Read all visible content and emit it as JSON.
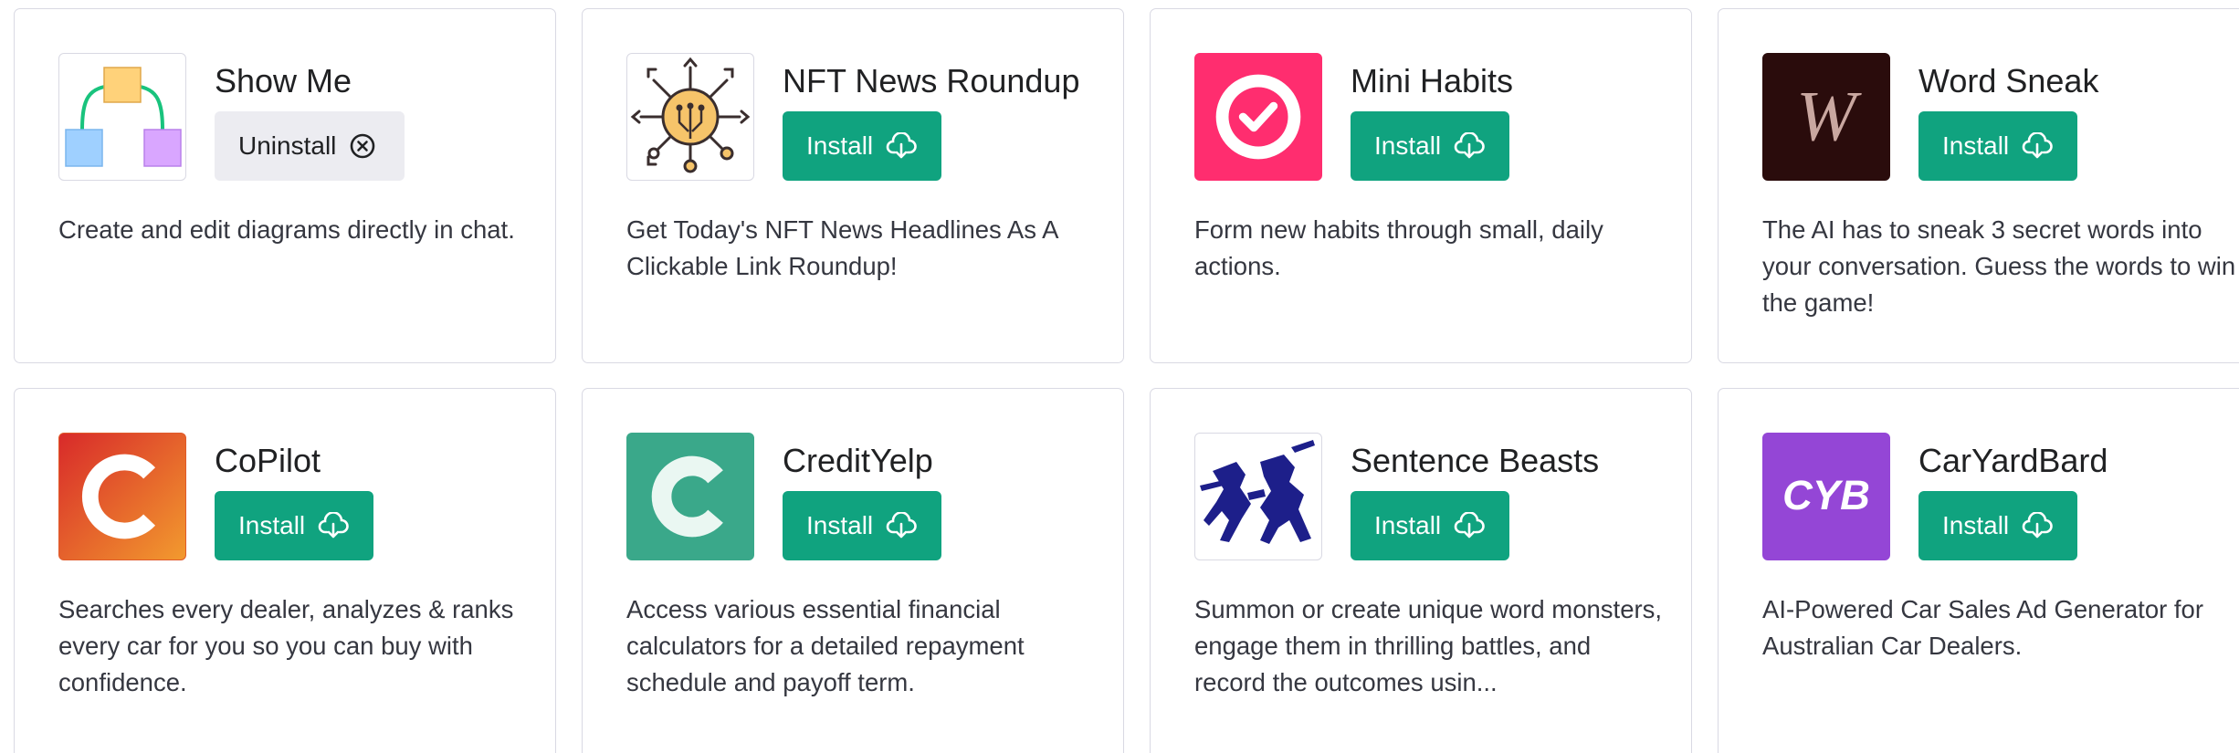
{
  "colors": {
    "install_bg": "#10a37f",
    "uninstall_bg": "#ececf1",
    "card_border": "#d9d9e3"
  },
  "plugins": [
    {
      "name": "Show Me",
      "action": "Uninstall",
      "action_icon": "circle-x-icon",
      "logo_icon": "diagram-logo-icon",
      "description": "Create and edit diagrams directly in chat."
    },
    {
      "name": "NFT News Roundup",
      "action": "Install",
      "action_icon": "download-cloud-icon",
      "logo_icon": "network-hub-logo-icon",
      "description": "Get Today's NFT News Headlines As A Clickable Link Roundup!"
    },
    {
      "name": "Mini Habits",
      "action": "Install",
      "action_icon": "download-cloud-icon",
      "logo_icon": "checkmark-logo-icon",
      "description": "Form new habits through small, daily actions."
    },
    {
      "name": "Word Sneak",
      "action": "Install",
      "action_icon": "download-cloud-icon",
      "logo_icon": "w-letter-logo-icon",
      "description": "The AI has to sneak 3 secret words into your conversation. Guess the words to win the game!"
    },
    {
      "name": "CoPilot",
      "action": "Install",
      "action_icon": "download-cloud-icon",
      "logo_icon": "c-orange-logo-icon",
      "description": "Searches every dealer, analyzes & ranks every car for you so you can buy with confidence."
    },
    {
      "name": "CreditYelp",
      "action": "Install",
      "action_icon": "download-cloud-icon",
      "logo_icon": "c-green-logo-icon",
      "description": "Access various essential financial calculators for a detailed repayment schedule and payoff term."
    },
    {
      "name": "Sentence Beasts",
      "action": "Install",
      "action_icon": "download-cloud-icon",
      "logo_icon": "warriors-logo-icon",
      "description": "Summon or create unique word monsters, engage them in thrilling battles, and record the outcomes usin..."
    },
    {
      "name": "CarYardBard",
      "action": "Install",
      "action_icon": "download-cloud-icon",
      "logo_icon": "cyb-logo-icon",
      "logo_text": "CYB",
      "description": "AI-Powered Car Sales Ad Generator for Australian Car Dealers."
    }
  ]
}
